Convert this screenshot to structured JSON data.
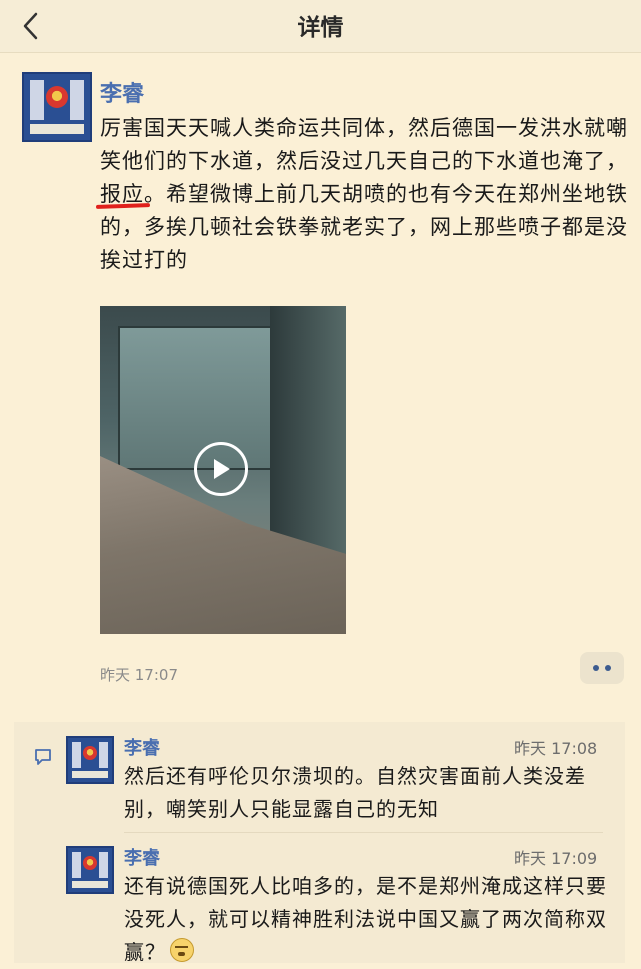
{
  "header": {
    "title": "详情",
    "back_icon": "chevron-left-icon"
  },
  "post": {
    "author": "李睿",
    "text_before": "厉害国天天喊人类命运共同体，然后德国一发洪水就嘲笑他们的下水道，然后没过几天自己的下水道也淹了，",
    "text_highlight": "报应",
    "text_after": "。希望微博上前几天胡喷的也有今天在郑州坐地铁的，多挨几顿社会铁拳就老实了，网上那些喷子都是没挨过打的",
    "time": "昨天 17:07",
    "video_icon": "play-icon",
    "more_icon": "more-dots-icon"
  },
  "comments": [
    {
      "author": "李睿",
      "time": "昨天 17:08",
      "text": "然后还有呼伦贝尔溃坝的。自然灾害面前人类没差别，嘲笑别人只能显露自己的无知"
    },
    {
      "author": "李睿",
      "time": "昨天 17:09",
      "text": "还有说德国死人比咱多的，是不是郑州淹成这样只要没死人，就可以精神胜利法说中国又赢了两次简称双赢？"
    }
  ],
  "colors": {
    "background": "#fbf0d6",
    "name_blue": "#4a6fb0",
    "underline_red": "#e0201c"
  }
}
